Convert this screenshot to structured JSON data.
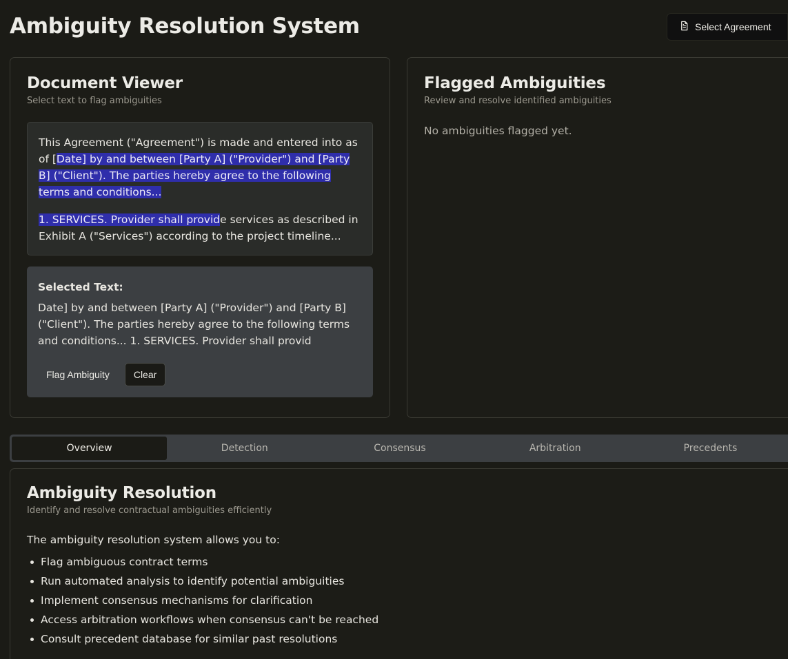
{
  "header": {
    "title": "Ambiguity Resolution System",
    "select_agreement_label": "Select Agreement",
    "select_agreement_icon": "document-icon"
  },
  "document_viewer": {
    "title": "Document Viewer",
    "subtitle": "Select text to flag ambiguities",
    "paragraph1": {
      "before": "This Agreement (\"Agreement\") is made and entered into as of [",
      "highlighted": "Date] by and between [Party A] (\"Provider\") and [Party B] (\"Client\"). The parties hereby agree to the following terms and conditions..."
    },
    "paragraph2": {
      "highlighted": "1. SERVICES. Provider shall provid",
      "after": "e services as described in Exhibit A (\"Services\") according to the project timeline..."
    },
    "selection": {
      "label": "Selected Text:",
      "text": "Date] by and between [Party A] (\"Provider\") and [Party B] (\"Client\"). The parties hereby agree to the following terms and conditions... 1. SERVICES. Provider shall provid",
      "flag_button": "Flag Ambiguity",
      "clear_button": "Clear"
    }
  },
  "flagged": {
    "title": "Flagged Ambiguities",
    "subtitle": "Review and resolve identified ambiguities",
    "empty_message": "No ambiguities flagged yet."
  },
  "tabs": [
    {
      "label": "Overview",
      "active": true
    },
    {
      "label": "Detection",
      "active": false
    },
    {
      "label": "Consensus",
      "active": false
    },
    {
      "label": "Arbitration",
      "active": false
    },
    {
      "label": "Precedents",
      "active": false
    }
  ],
  "overview": {
    "title": "Ambiguity Resolution",
    "subtitle": "Identify and resolve contractual ambiguities efficiently",
    "intro": "The ambiguity resolution system allows you to:",
    "features": [
      "Flag ambiguous contract terms",
      "Run automated analysis to identify potential ambiguities",
      "Implement consensus mechanisms for clarification",
      "Access arbitration workflows when consensus can't be reached",
      "Consult precedent database for similar past resolutions"
    ]
  },
  "colors": {
    "background": "#1b1b16",
    "highlight": "#2f2eab",
    "panel": "#3c3f42"
  }
}
